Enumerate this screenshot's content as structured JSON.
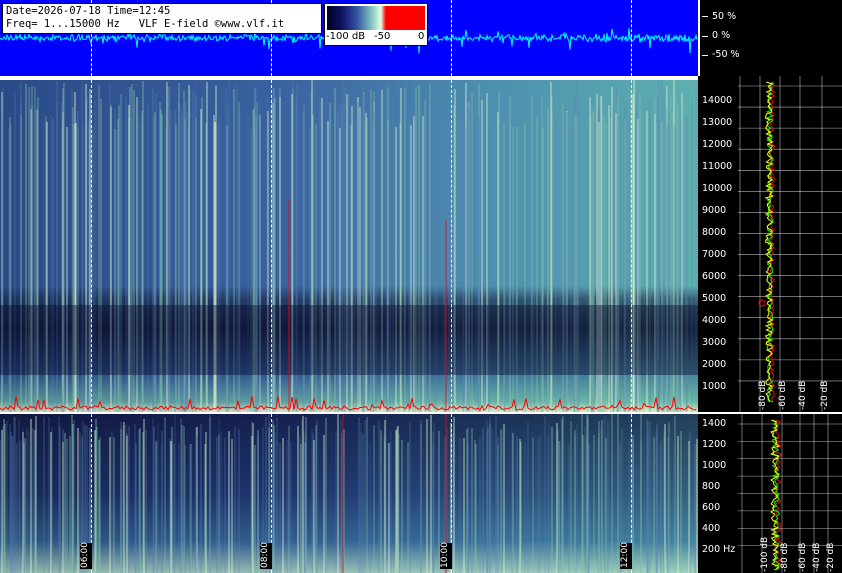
{
  "header": {
    "line1": "Date=2026-07-18 Time=12:45",
    "line2": "Freq= 1...15000 Hz   VLF E-field ©www.vlf.it"
  },
  "colorbar": {
    "label_min": "-100 dB",
    "label_mid": "-50",
    "label_max": "0"
  },
  "amplitude_scale": {
    "labels": [
      "50 %",
      "0 %",
      "-50 %"
    ]
  },
  "upper_panel": {
    "freq_labels": [
      "14000",
      "13000",
      "12000",
      "11000",
      "10000",
      "9000",
      "8000",
      "7000",
      "6000",
      "5000",
      "4000",
      "3000",
      "2000",
      "1000"
    ],
    "db_axis_labels": [
      "-80 dB",
      "-60 dB",
      "-40 dB",
      "-20 dB"
    ]
  },
  "lower_panel": {
    "freq_labels": [
      "1400",
      "1200",
      "1000",
      "800",
      "600",
      "400",
      "200 Hz"
    ],
    "db_axis_labels": [
      "-100 dB",
      "-80 dB",
      "-60 dB",
      "-40 dB",
      "-20 dB"
    ]
  },
  "time_labels": [
    "06:00",
    "08:00",
    "10:00",
    "12:00"
  ],
  "colors": {
    "waveform_bg": "#0000ff",
    "waveform_trace": "#00ffff",
    "spectro_base": "#2a4a86",
    "grid": "#ffffff",
    "trace_red": "#ff0000",
    "trace_green": "#00ff00",
    "trace_yellow": "#ffff00"
  }
}
